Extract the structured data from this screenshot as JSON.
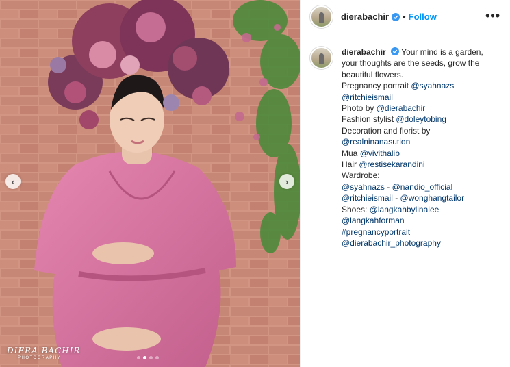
{
  "post": {
    "username": "dierabachir",
    "follow_label": "Follow",
    "more_label": "•••",
    "bullet": "•"
  },
  "photo": {
    "watermark_name": "DIERA BACHIR",
    "watermark_sub": "PHOTOGRAPHY",
    "prev_icon": "chevron-left-icon",
    "next_icon": "chevron-right-icon",
    "slide_count": 4,
    "active_slide": 2
  },
  "caption": {
    "username": "dierabachir",
    "text": "Your mind is a garden, your thoughts are the seeds, grow the beautiful flowers.",
    "l1": "Pregnancy portrait",
    "m1": "@syahnazs",
    "m2": "@ritchieismail",
    "l3": "Photo by",
    "m3": "@dierabachir",
    "l4": "Fashion stylist",
    "m4": "@doleytobing",
    "l5": "Decoration and florist by",
    "m5": "@realninanasution",
    "l6": "Mua",
    "m6": "@vivithalib",
    "l7": "Hair",
    "m7": "@restisekarandini",
    "l8": "Wardrobe:",
    "m8": "@syahnazs",
    "dash": " - ",
    "m9": "@nandio_official",
    "m10": "@ritchieismail",
    "m11": "@wonghangtailor",
    "l9": "Shoes:",
    "m12": "@langkahbylinalee",
    "m13": "@langkahforman",
    "m14": "#pregnancyportrait",
    "m15": "@dierabachir_photography"
  },
  "colors": {
    "accent": "#0095f6",
    "mention": "#00376b",
    "verified": "#3897f0",
    "dress": "#d9729e",
    "brick": "#b86f5c"
  }
}
